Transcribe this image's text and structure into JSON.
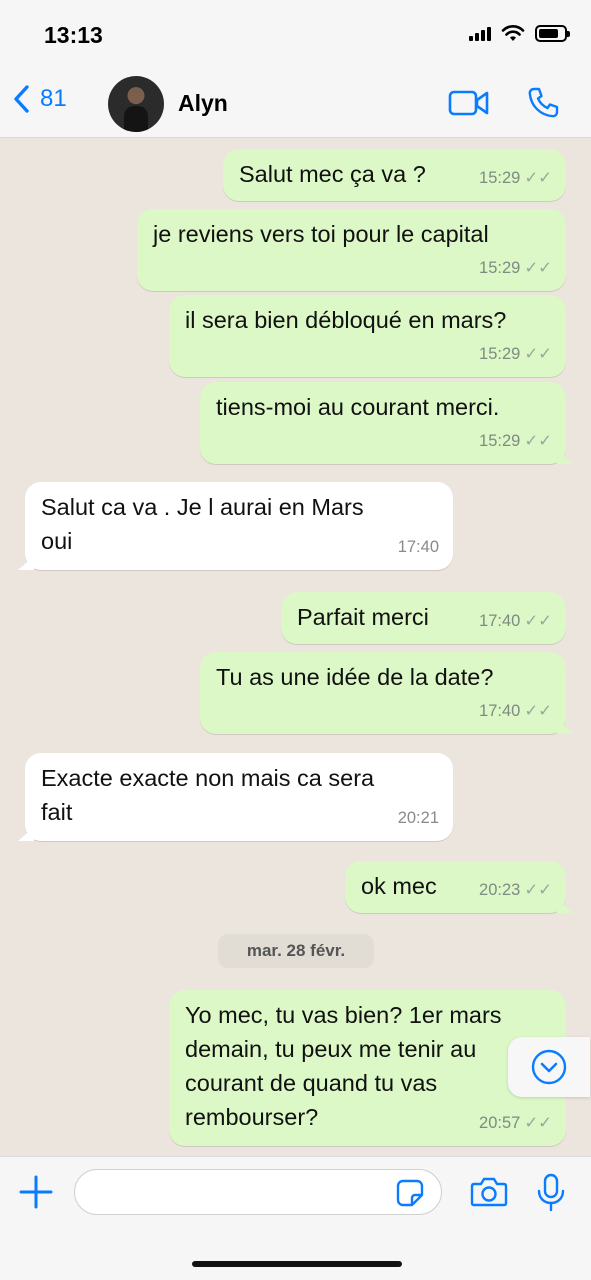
{
  "status_bar": {
    "time": "13:13"
  },
  "header": {
    "back_count": "81",
    "contact_name": "Alyn",
    "icons": [
      "chevron-left-icon",
      "video-call-icon",
      "phone-call-icon"
    ]
  },
  "messages": [
    {
      "dir": "out",
      "text": "Salut mec ça va ?",
      "time": "15:29",
      "status": "read"
    },
    {
      "dir": "out",
      "text": "je reviens vers toi pour le capital",
      "time": "15:29",
      "status": "read"
    },
    {
      "dir": "out",
      "text": "il sera bien débloqué en mars?",
      "time": "15:29",
      "status": "read"
    },
    {
      "dir": "out",
      "text": "tiens-moi au courant merci.",
      "time": "15:29",
      "status": "read"
    },
    {
      "dir": "in",
      "text": "Salut ca va . Je l aurai en Mars oui",
      "time": "17:40"
    },
    {
      "dir": "out",
      "text": "Parfait merci",
      "time": "17:40",
      "status": "read"
    },
    {
      "dir": "out",
      "text": "Tu as une idée de la date?",
      "time": "17:40",
      "status": "read"
    },
    {
      "dir": "in",
      "text": "Exacte exacte non mais ca sera fait",
      "time": "20:21"
    },
    {
      "dir": "out",
      "text": "ok mec",
      "time": "20:23",
      "status": "read"
    },
    {
      "dir": "out",
      "text": "Yo mec, tu vas bien? 1er mars demain, tu peux me tenir au courant de quand tu vas rembourser?",
      "time": "20:57",
      "status": "read"
    }
  ],
  "date_separator": "mar. 28 févr.",
  "composer": {
    "placeholder": ""
  },
  "colors": {
    "accent": "#0a7cff",
    "outgoing_bubble": "#dcf8c6",
    "incoming_bubble": "#ffffff",
    "chat_bg": "#ece5dd"
  }
}
